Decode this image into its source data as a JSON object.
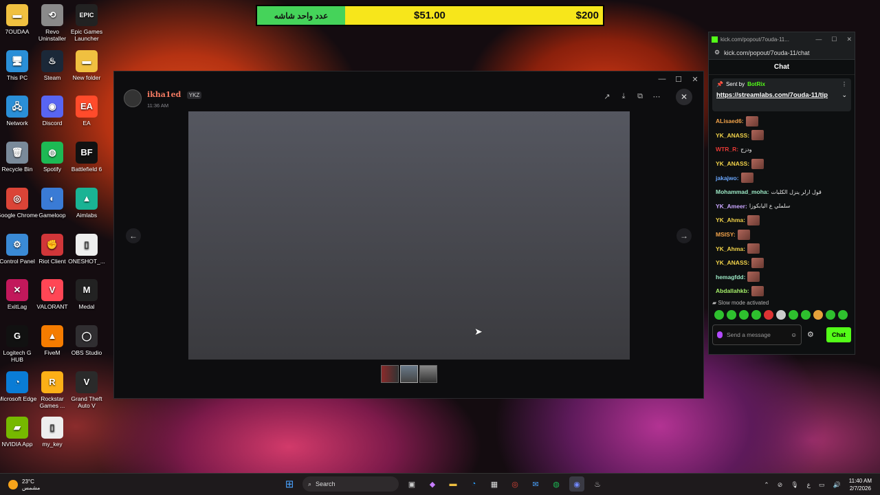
{
  "desktop_icons": [
    {
      "label": "7OUDAA",
      "icon": "folder-icon",
      "color": "#f0c040"
    },
    {
      "label": "Revo Uninstaller",
      "icon": "revo-icon",
      "color": "#8a8a8a"
    },
    {
      "label": "Epic Games Launcher",
      "icon": "epic-games-icon",
      "color": "#222222"
    },
    {
      "label": "This PC",
      "icon": "monitor-icon",
      "color": "#2a8fd8"
    },
    {
      "label": "Steam",
      "icon": "steam-icon",
      "color": "#1b2838"
    },
    {
      "label": "New folder",
      "icon": "folder-icon",
      "color": "#f0c040"
    },
    {
      "label": "Network",
      "icon": "network-icon",
      "color": "#2a8fd8"
    },
    {
      "label": "Discord",
      "icon": "discord-icon",
      "color": "#5865f2"
    },
    {
      "label": "EA",
      "icon": "ea-icon",
      "color": "#ff4b2b"
    },
    {
      "label": "Recycle Bin",
      "icon": "recycle-bin-icon",
      "color": "#7a8a9a"
    },
    {
      "label": "Spotify",
      "icon": "spotify-icon",
      "color": "#1db954"
    },
    {
      "label": "Battlefield 6",
      "icon": "battlefield-icon",
      "color": "#111111"
    },
    {
      "label": "Google Chrome",
      "icon": "chrome-icon",
      "color": "#db4437"
    },
    {
      "label": "Gameloop",
      "icon": "gameloop-icon",
      "color": "#3a7bd5"
    },
    {
      "label": "Aimlabs",
      "icon": "aimlabs-icon",
      "color": "#1ab394"
    },
    {
      "label": "Control Panel",
      "icon": "control-panel-icon",
      "color": "#3a8ad5"
    },
    {
      "label": "Riot Client",
      "icon": "riot-icon",
      "color": "#d13639"
    },
    {
      "label": "ONESHOT_...",
      "icon": "document-icon",
      "color": "#eeeeee"
    },
    {
      "label": "ExitLag",
      "icon": "exitlag-icon",
      "color": "#c2185b"
    },
    {
      "label": "VALORANT",
      "icon": "valorant-icon",
      "color": "#ff4655"
    },
    {
      "label": "Medal",
      "icon": "medal-icon",
      "color": "#222222"
    },
    {
      "label": "Logitech G HUB",
      "icon": "logitech-icon",
      "color": "#111111"
    },
    {
      "label": "FiveM",
      "icon": "fivem-icon",
      "color": "#f57c00"
    },
    {
      "label": "OBS Studio",
      "icon": "obs-icon",
      "color": "#302e31"
    },
    {
      "label": "Microsoft Edge",
      "icon": "edge-icon",
      "color": "#0a7cd6"
    },
    {
      "label": "Rockstar Games ...",
      "icon": "rockstar-icon",
      "color": "#fcaf17"
    },
    {
      "label": "Grand Theft Auto V",
      "icon": "gta-icon",
      "color": "#2a2a2a"
    },
    {
      "label": "NVIDIA App",
      "icon": "nvidia-icon",
      "color": "#76b900"
    },
    {
      "label": "my_key",
      "icon": "document-icon",
      "color": "#eeeeee"
    }
  ],
  "icon_glyphs": [
    "▬",
    "⟲",
    "EPIC",
    "🖥",
    "♨",
    "▬",
    "🖧",
    "◉",
    "EA",
    "🗑",
    "◍",
    "BF",
    "◎",
    "◐",
    "▲",
    "⚙",
    "✊",
    "▯",
    "✕",
    "V",
    "M",
    "G",
    "▲",
    "◯",
    "◔",
    "R",
    "V",
    "▰",
    "▯"
  ],
  "donation_bar": {
    "label": "عدد واحد شاشه",
    "current": "$51.00",
    "goal": "$200",
    "progress": 0.255
  },
  "discord": {
    "username": "ikha1ed",
    "user_tag": "YKZ",
    "timestamp": "11:36 AM",
    "tools": [
      "↗",
      "⤓",
      "⧉",
      "⋯"
    ],
    "close": "✕",
    "prev": "←",
    "next": "→",
    "window_controls": [
      "—",
      "☐",
      "✕"
    ]
  },
  "kick": {
    "window_title": "kick.com/popout/7ouda-11...",
    "url": "kick.com/popout/7ouda-11/chat",
    "chat_title": "Chat",
    "pinned_sender_prefix": "Sent by",
    "pinned_sender": "BotRix",
    "pinned_link": "https://streamlabs.com/7ouda-11/tip",
    "messages": [
      {
        "user": "ALisaed6:",
        "color": "#f2a34a",
        "text": "",
        "emote": true
      },
      {
        "user": "YK_ANASS:",
        "color": "#f2d34a",
        "text": "",
        "emote": true
      },
      {
        "user": "WTR_R:",
        "color": "#e53935",
        "text": "ودزج",
        "emote": false
      },
      {
        "user": "YK_ANASS:",
        "color": "#f2d34a",
        "text": "",
        "emote": true
      },
      {
        "user": "jakajwo:",
        "color": "#6aa8ff",
        "text": "",
        "emote": true
      },
      {
        "user": "Mohammad_moha:",
        "color": "#9be7c4",
        "text": "قول ارلر ينزل الكلبات",
        "emote": false
      },
      {
        "user": "YK_Ameer:",
        "color": "#c9a6ff",
        "text": "سلملي ع اليابكوزا",
        "emote": false
      },
      {
        "user": "YK_Ahma:",
        "color": "#f2d34a",
        "text": "",
        "emote": true
      },
      {
        "user": "MSISY:",
        "color": "#f2a34a",
        "text": "",
        "emote": true
      },
      {
        "user": "YK_Ahma:",
        "color": "#f2d34a",
        "text": "",
        "emote": true
      },
      {
        "user": "YK_ANASS:",
        "color": "#f2d34a",
        "text": "",
        "emote": true
      },
      {
        "user": "hemagfdd:",
        "color": "#9be7c4",
        "text": "",
        "emote": true
      },
      {
        "user": "Abdallahkb:",
        "color": "#a6f06a",
        "text": "",
        "emote": true
      }
    ],
    "slow_mode": "Slow mode activated",
    "input_placeholder": "Send a message",
    "send_label": "Chat"
  },
  "taskbar": {
    "temperature": "23°C",
    "weather": "مشمس",
    "search_label": "Search",
    "time": "11:40 AM",
    "date": "2/7/2026",
    "lang": "ع"
  }
}
